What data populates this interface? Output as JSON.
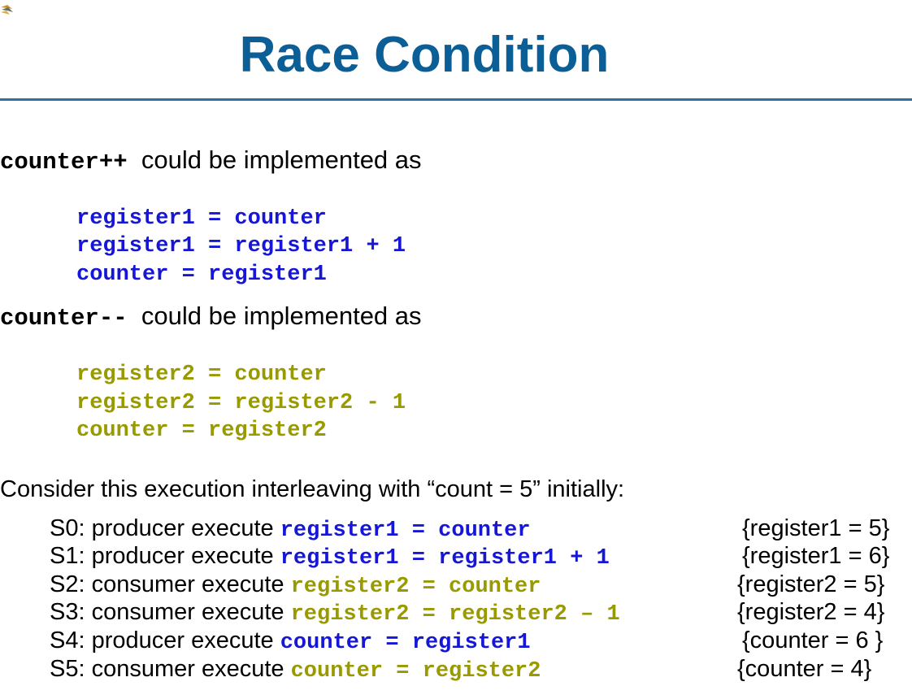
{
  "title": "Race Condition",
  "increment": {
    "keyword": "counter++",
    "text": "could be implemented as",
    "code": [
      "register1 = counter",
      "register1 = register1 + 1",
      "counter = register1"
    ]
  },
  "decrement": {
    "keyword": "counter--",
    "text": "could be implemented as",
    "code": [
      "register2 = counter",
      "register2 = register2 - 1",
      "counter = register2"
    ]
  },
  "intro": "Consider this execution interleaving with “count = 5” initially:",
  "steps": [
    {
      "label": "S0: producer execute ",
      "code": "register1 = counter",
      "result": "{register1 = 5}"
    },
    {
      "label": "S1: producer execute ",
      "code": "register1 = register1 + 1",
      "result": "{register1 = 6}"
    },
    {
      "label": "S2: consumer execute ",
      "code": "register2 = counter",
      "result": "{register2 = 5}"
    },
    {
      "label": "S3: consumer execute ",
      "code": "register2 = register2 – 1",
      "result": "{register2 = 4}"
    },
    {
      "label": "S4: producer execute ",
      "code": "counter = register1",
      "result": "{counter = 6 }"
    },
    {
      "label": "S5: consumer execute ",
      "code": "counter = register2",
      "result": "{counter = 4}"
    }
  ],
  "colors": {
    "title": "#0b5f96",
    "producer_code": "#1616d6",
    "consumer_code": "#999900",
    "rule": "#2e6fa7"
  },
  "icons": {
    "corner": "bird-logo-icon"
  }
}
